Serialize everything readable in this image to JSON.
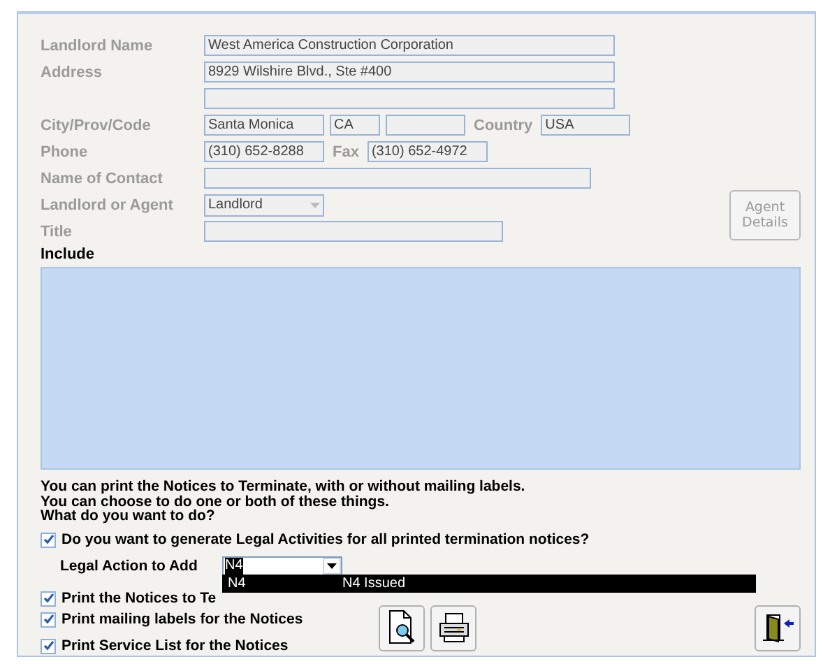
{
  "form_rows": [
    {
      "label": "Landlord Name",
      "items": [
        {
          "kind": "field",
          "value": "West America Construction Corporation"
        }
      ]
    },
    {
      "label": "Address",
      "items": [
        {
          "kind": "field",
          "value": "8929 Wilshire Blvd., Ste #400"
        }
      ]
    },
    {
      "items": [
        {
          "kind": "field"
        }
      ]
    },
    {
      "label": "City/Prov/Code",
      "items": [
        {
          "kind": "field",
          "value": "Santa Monica"
        },
        {
          "kind": "field",
          "value": "CA"
        },
        {
          "kind": "field"
        },
        {
          "kind": "label",
          "text": "Country"
        },
        {
          "kind": "field",
          "value": "USA"
        }
      ]
    },
    {
      "label": "Phone",
      "items": [
        {
          "kind": "field",
          "value": "(310) 652-8288"
        },
        {
          "kind": "label",
          "text": "Fax"
        },
        {
          "kind": "field",
          "value": "(310) 652-4972"
        }
      ]
    },
    {
      "label": "Name of Contact",
      "items": [
        {
          "kind": "field"
        }
      ]
    },
    {
      "label": "Landlord or Agent",
      "items": [
        {
          "kind": "combo",
          "value": "Landlord"
        }
      ]
    },
    {
      "label": "Title",
      "items": [
        {
          "kind": "field"
        }
      ]
    }
  ],
  "agent_button": {
    "label": "Agent\nDetails",
    "disabled": true
  },
  "include": {
    "label": "Include"
  },
  "instructions": [
    "You can print the Notices to Terminate, with or without mailing labels.",
    "You can choose to do one or both of these things.",
    "What do you want to do?"
  ],
  "legal_activities": {
    "label": "Do you want to generate Legal Activities for all printed termination notices?",
    "checked": true
  },
  "legal_action": {
    "label": "Legal Action to Add",
    "value": "N4",
    "dropdown": [
      {
        "code": "N4",
        "description": "N4 Issued",
        "selected": true
      }
    ]
  },
  "print_options": [
    {
      "label": "Print the Notices to Te",
      "checked": true
    },
    {
      "label": "Print mailing labels for the Notices",
      "checked": true
    },
    {
      "label": "Print Service List for the Notices",
      "checked": true
    }
  ]
}
